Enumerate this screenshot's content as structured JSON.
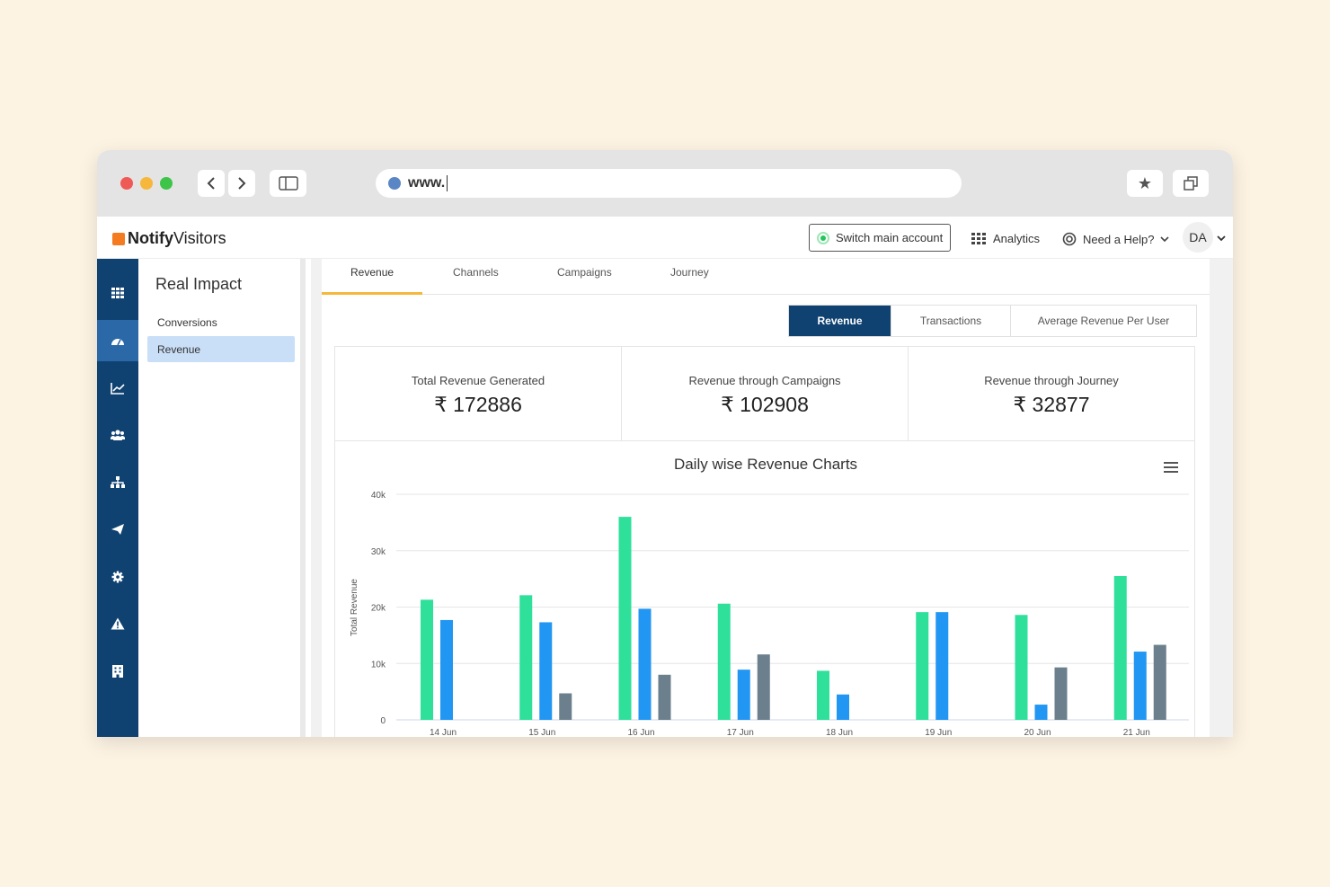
{
  "browser": {
    "url": "www."
  },
  "app": {
    "logo_bold": "Notify",
    "logo_rest": "Visitors",
    "switch_label": "Switch main account",
    "analytics_label": "Analytics",
    "help_label": "Need a Help?",
    "user_initials": "DA"
  },
  "rail": {
    "icons": [
      "grid-icon",
      "dashboard-icon",
      "line-chart-icon",
      "users-icon",
      "sitemap-icon",
      "send-icon",
      "settings-icon",
      "alert-icon",
      "building-icon"
    ]
  },
  "sidebar": {
    "title": "Real Impact",
    "items": [
      {
        "label": "Conversions"
      },
      {
        "label": "Revenue"
      }
    ]
  },
  "tabs": [
    {
      "label": "Revenue"
    },
    {
      "label": "Channels"
    },
    {
      "label": "Campaigns"
    },
    {
      "label": "Journey"
    }
  ],
  "segment": [
    {
      "label": "Revenue"
    },
    {
      "label": "Transactions"
    },
    {
      "label": "Average Revenue Per User"
    }
  ],
  "stats": [
    {
      "label": "Total Revenue Generated",
      "value": "₹ 172886"
    },
    {
      "label": "Revenue through Campaigns",
      "value": "₹ 102908"
    },
    {
      "label": "Revenue through Journey",
      "value": "₹ 32877"
    }
  ],
  "colors": {
    "accent": "#0f4171",
    "tab_underline": "#f6b73c"
  },
  "chart_data": {
    "type": "bar",
    "title": "Daily wise Revenue Charts",
    "ylabel": "Total Revenue",
    "xlabel": "",
    "ylim": [
      0,
      40000
    ],
    "yticks": [
      0,
      10000,
      20000,
      30000,
      40000
    ],
    "ytick_labels": [
      "0",
      "10k",
      "20k",
      "30k",
      "40k"
    ],
    "categories": [
      "14 Jun",
      "15 Jun",
      "16 Jun",
      "17 Jun",
      "18 Jun",
      "19 Jun",
      "20 Jun",
      "21 Jun"
    ],
    "series": [
      {
        "color": "#2ee09a",
        "values": [
          21300,
          22100,
          36000,
          20600,
          8700,
          19100,
          18600,
          25500
        ]
      },
      {
        "color": "#2196f3",
        "values": [
          17700,
          17300,
          19700,
          8900,
          4500,
          19100,
          2700,
          12100
        ]
      },
      {
        "color": "#6c7f8c",
        "values": [
          0,
          4700,
          8000,
          11600,
          0,
          0,
          9300,
          13300
        ]
      }
    ],
    "grid": true,
    "legend": "none"
  }
}
